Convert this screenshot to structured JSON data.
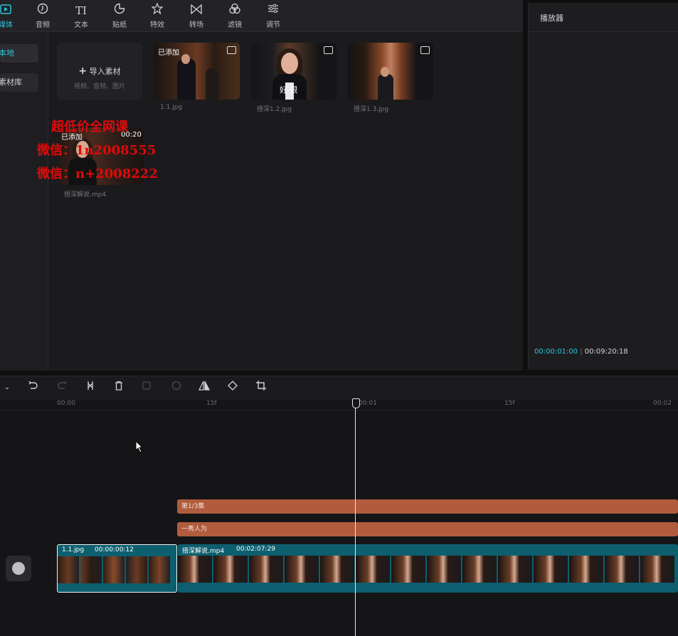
{
  "toolbar": {
    "tabs": [
      {
        "label": "媒体",
        "icon": "media-icon",
        "active": true
      },
      {
        "label": "音频",
        "icon": "audio-icon"
      },
      {
        "label": "文本",
        "icon": "text-icon",
        "glyph": "TI"
      },
      {
        "label": "贴纸",
        "icon": "sticker-icon"
      },
      {
        "label": "特效",
        "icon": "effects-icon"
      },
      {
        "label": "转场",
        "icon": "transition-icon"
      },
      {
        "label": "滤镜",
        "icon": "filter-icon"
      },
      {
        "label": "调节",
        "icon": "adjust-icon"
      }
    ]
  },
  "leftnav": {
    "items": [
      {
        "label": "本地"
      },
      {
        "label": "素材库"
      }
    ]
  },
  "media": {
    "import_label": "导入素材",
    "import_hint": "视频、音频、图片",
    "items": [
      {
        "name": "1.1.jpg",
        "badge": "已添加"
      },
      {
        "name": "捂深1.2.jpg"
      },
      {
        "name": "捂深1.3.jpg"
      },
      {
        "name": "捂深解说.mp4",
        "badge": "已添加",
        "duration": "00:20"
      }
    ],
    "photo_caption": "好 很",
    "watermark": [
      "超低价全网课",
      "微信：1n2008555",
      "微信：n+2008222"
    ]
  },
  "player": {
    "title": "播放器",
    "current_time": "00:00:01:00",
    "total_time": "00:09:20:18"
  },
  "timeline": {
    "ruler": [
      "00:00",
      "15f",
      "00:01",
      "15f",
      "00:02"
    ],
    "text_clips": [
      {
        "label": "第1/3集"
      },
      {
        "label": "一秀人为"
      }
    ],
    "video_clips": [
      {
        "name": "1.1.jpg",
        "duration": "00:00:00:12"
      },
      {
        "name": "捂深解说.mp4",
        "duration": "00:02:07:29"
      }
    ]
  },
  "colors": {
    "accent": "#2bc4d8",
    "text_clip": "#b15c3d",
    "video_track": "#0d5f6f"
  }
}
